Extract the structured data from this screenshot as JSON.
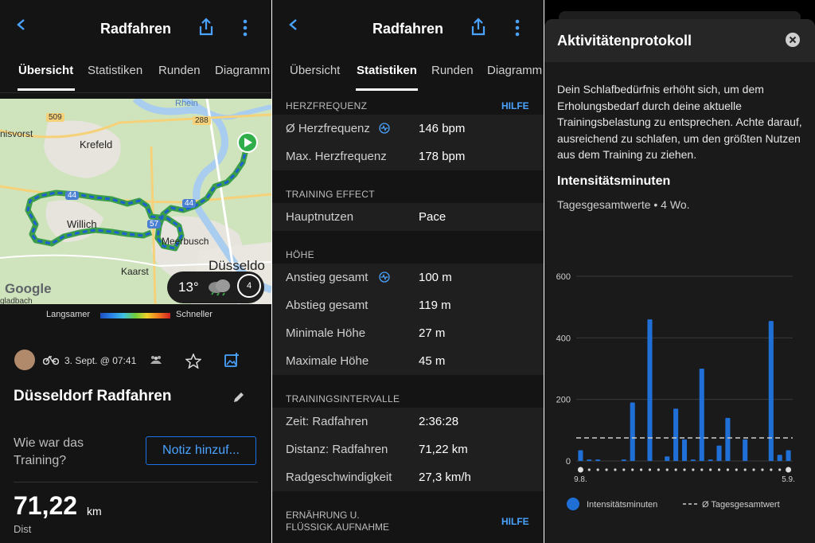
{
  "panel1": {
    "title": "Radfahren",
    "tabs": [
      "Übersicht",
      "Statistiken",
      "Runden",
      "Diagramm"
    ],
    "map": {
      "labels": {
        "rhein": "Rhein",
        "r509": "509",
        "r288": "288",
        "anisvorst": "nisvorst",
        "krefeld": "Krefeld",
        "willich": "Willich",
        "meerbusch": "Meerbusch",
        "kaarst": "Kaarst",
        "duesseldorf": "Düsseldo",
        "a44a": "44",
        "a44b": "44",
        "a57": "57",
        "google": "Google",
        "bottom": "gladbach"
      }
    },
    "weather": {
      "temp": "13°",
      "wind": "4"
    },
    "legend": {
      "slower": "Langsamer",
      "faster": "Schneller"
    },
    "activity": {
      "date": "3. Sept. @ 07:41",
      "name": "Düsseldorf Radfahren",
      "question": "Wie war das Training?",
      "note_button": "Notiz hinzuf...",
      "distance_value": "71,22",
      "distance_unit": "km",
      "distance_label": "Dist"
    },
    "colors": {
      "accent": "#1a73e8"
    }
  },
  "panel2": {
    "title": "Radfahren",
    "tabs": [
      "Übersicht",
      "Statistiken",
      "Runden",
      "Diagramm"
    ],
    "help": "HILFE",
    "sections": [
      {
        "header": "HERZFREQUENZ",
        "help": true,
        "rows": [
          {
            "label": "Ø Herzfrequenz",
            "value": "146 bpm",
            "icon": true
          },
          {
            "label": "Max. Herzfrequenz",
            "value": "178 bpm",
            "icon": false
          }
        ]
      },
      {
        "header": "TRAINING EFFECT",
        "help": false,
        "rows": [
          {
            "label": "Hauptnutzen",
            "value": "Pace",
            "icon": false
          }
        ]
      },
      {
        "header": "HÖHE",
        "help": false,
        "rows": [
          {
            "label": "Anstieg gesamt",
            "value": "100 m",
            "icon": true
          },
          {
            "label": "Abstieg gesamt",
            "value": "119 m",
            "icon": false
          },
          {
            "label": "Minimale Höhe",
            "value": "27 m",
            "icon": false
          },
          {
            "label": "Maximale Höhe",
            "value": "45 m",
            "icon": false
          }
        ]
      },
      {
        "header": "TRAININGSINTERVALLE",
        "help": false,
        "rows": [
          {
            "label": "Zeit: Radfahren",
            "value": "2:36:28",
            "icon": false
          },
          {
            "label": "Distanz: Radfahren",
            "value": "71,22 km",
            "icon": false
          },
          {
            "label": "Radgeschwindigkeit",
            "value": "27,3 km/h",
            "icon": false
          }
        ]
      }
    ],
    "last_header_line1": "ERNÄHRUNG U.",
    "last_header_line2": "FLÜSSIGK.AUFNAHME"
  },
  "panel3": {
    "sheet_title": "Aktivitätenprotokoll",
    "description": "Dein Schlafbedürfnis erhöht sich, um dem Erholungsbedarf durch deine aktuelle Trainingsbelastung zu entsprechen. Achte darauf, ausreichend zu schlafen, um den größten Nutzen aus dem Training zu ziehen.",
    "section_title": "Intensitätsminuten",
    "section_sub": "Tagesgesamtwerte • 4 Wo.",
    "legend_bar": "Intensitätsminuten",
    "legend_avg": "Ø Tagesgesamtwert",
    "colors": {
      "bar": "#1f6fd6",
      "avg": "#cccccc"
    }
  },
  "chart_data": {
    "type": "bar",
    "ylim": [
      0,
      600
    ],
    "yticks": [
      "600",
      "400",
      "200",
      "0"
    ],
    "x_start_label": "9.8.",
    "x_end_label": "5.9.",
    "average": 75,
    "values": [
      35,
      5,
      5,
      0,
      0,
      5,
      190,
      0,
      460,
      0,
      15,
      170,
      70,
      5,
      300,
      5,
      50,
      140,
      0,
      70,
      0,
      0,
      455,
      20,
      35
    ],
    "grid": true,
    "legend_placement": "bottom"
  }
}
